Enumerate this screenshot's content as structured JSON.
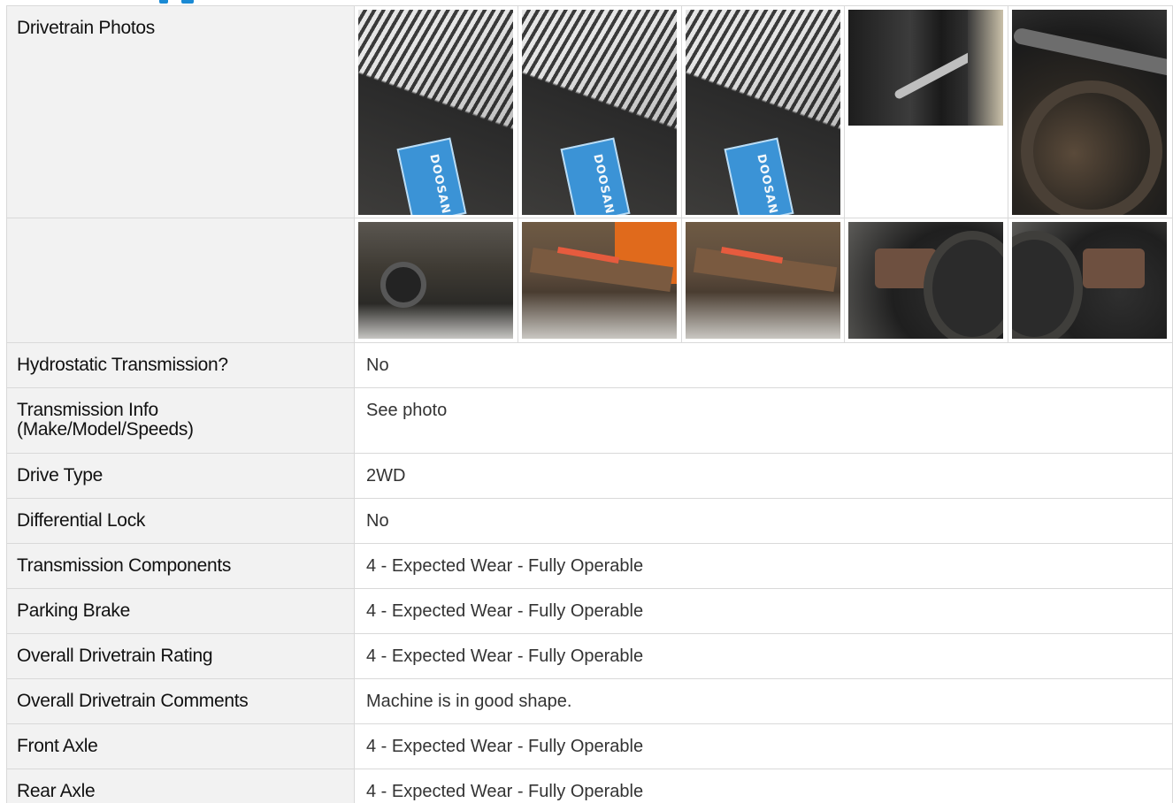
{
  "header": {
    "accent_color": "#1a8ad4"
  },
  "photos": {
    "label": "Drivetrain Photos",
    "row1": [
      {
        "icon": "transmission-plate-photo",
        "plate_text": "DOOSAN"
      },
      {
        "icon": "transmission-plate-photo",
        "plate_text": "DOOSAN"
      },
      {
        "icon": "transmission-plate-photo",
        "plate_text": "DOOSAN"
      },
      {
        "icon": "hydraulic-lines-photo"
      },
      {
        "icon": "wheel-hub-photo"
      }
    ],
    "row2": [
      {
        "icon": "brake-sensor-photo"
      },
      {
        "icon": "steering-linkage-photo"
      },
      {
        "icon": "tie-rod-photo"
      },
      {
        "icon": "front-axle-photo"
      },
      {
        "icon": "tire-knuckle-photo"
      }
    ]
  },
  "rows": [
    {
      "label": "Hydrostatic Transmission?",
      "value": "No"
    },
    {
      "label": "Transmission Info",
      "label2": "(Make/Model/Speeds)",
      "value": "See photo"
    },
    {
      "label": "Drive Type",
      "value": "2WD"
    },
    {
      "label": "Differential Lock",
      "value": "No"
    },
    {
      "label": "Transmission Components",
      "value": "4 - Expected Wear - Fully Operable"
    },
    {
      "label": "Parking Brake",
      "value": "4 - Expected Wear - Fully Operable"
    },
    {
      "label": "Overall Drivetrain Rating",
      "value": "4 - Expected Wear - Fully Operable"
    },
    {
      "label": "Overall Drivetrain Comments",
      "value": "Machine is in good shape."
    },
    {
      "label": "Front Axle",
      "value": "4 - Expected Wear - Fully Operable"
    },
    {
      "label": "Rear Axle",
      "value": "4 - Expected Wear - Fully Operable"
    }
  ]
}
